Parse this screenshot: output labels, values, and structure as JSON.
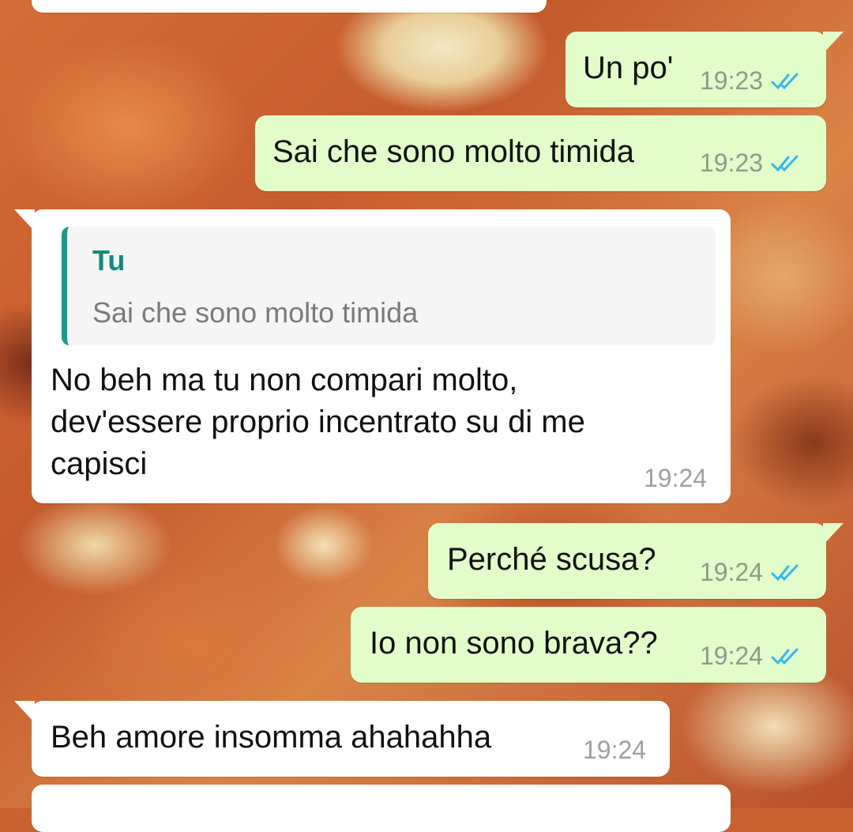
{
  "chat": {
    "messages": [
      {
        "direction": "outgoing",
        "text": "Un po'",
        "time": "19:23",
        "status": "read"
      },
      {
        "direction": "outgoing",
        "text": "Sai che sono molto timida",
        "time": "19:23",
        "status": "read"
      },
      {
        "direction": "incoming",
        "quote": {
          "author": "Tu",
          "text": "Sai che sono molto timida"
        },
        "text": "No beh ma tu non compari molto,\ndev'essere proprio incentrato su di me\ncapisci",
        "time": "19:24"
      },
      {
        "direction": "outgoing",
        "text": "Perché scusa?",
        "time": "19:24",
        "status": "read"
      },
      {
        "direction": "outgoing",
        "text": "Io non sono brava??",
        "time": "19:24",
        "status": "read"
      },
      {
        "direction": "incoming",
        "text": "Beh amore insomma ahahahha",
        "time": "19:24"
      }
    ]
  },
  "colors": {
    "outgoing_bubble": "#e2fdc9",
    "incoming_bubble": "#ffffff",
    "read_ticks": "#34b7f1",
    "quote_accent": "#1b9a8a"
  },
  "icons": {
    "read_status": "double-check-icon"
  }
}
